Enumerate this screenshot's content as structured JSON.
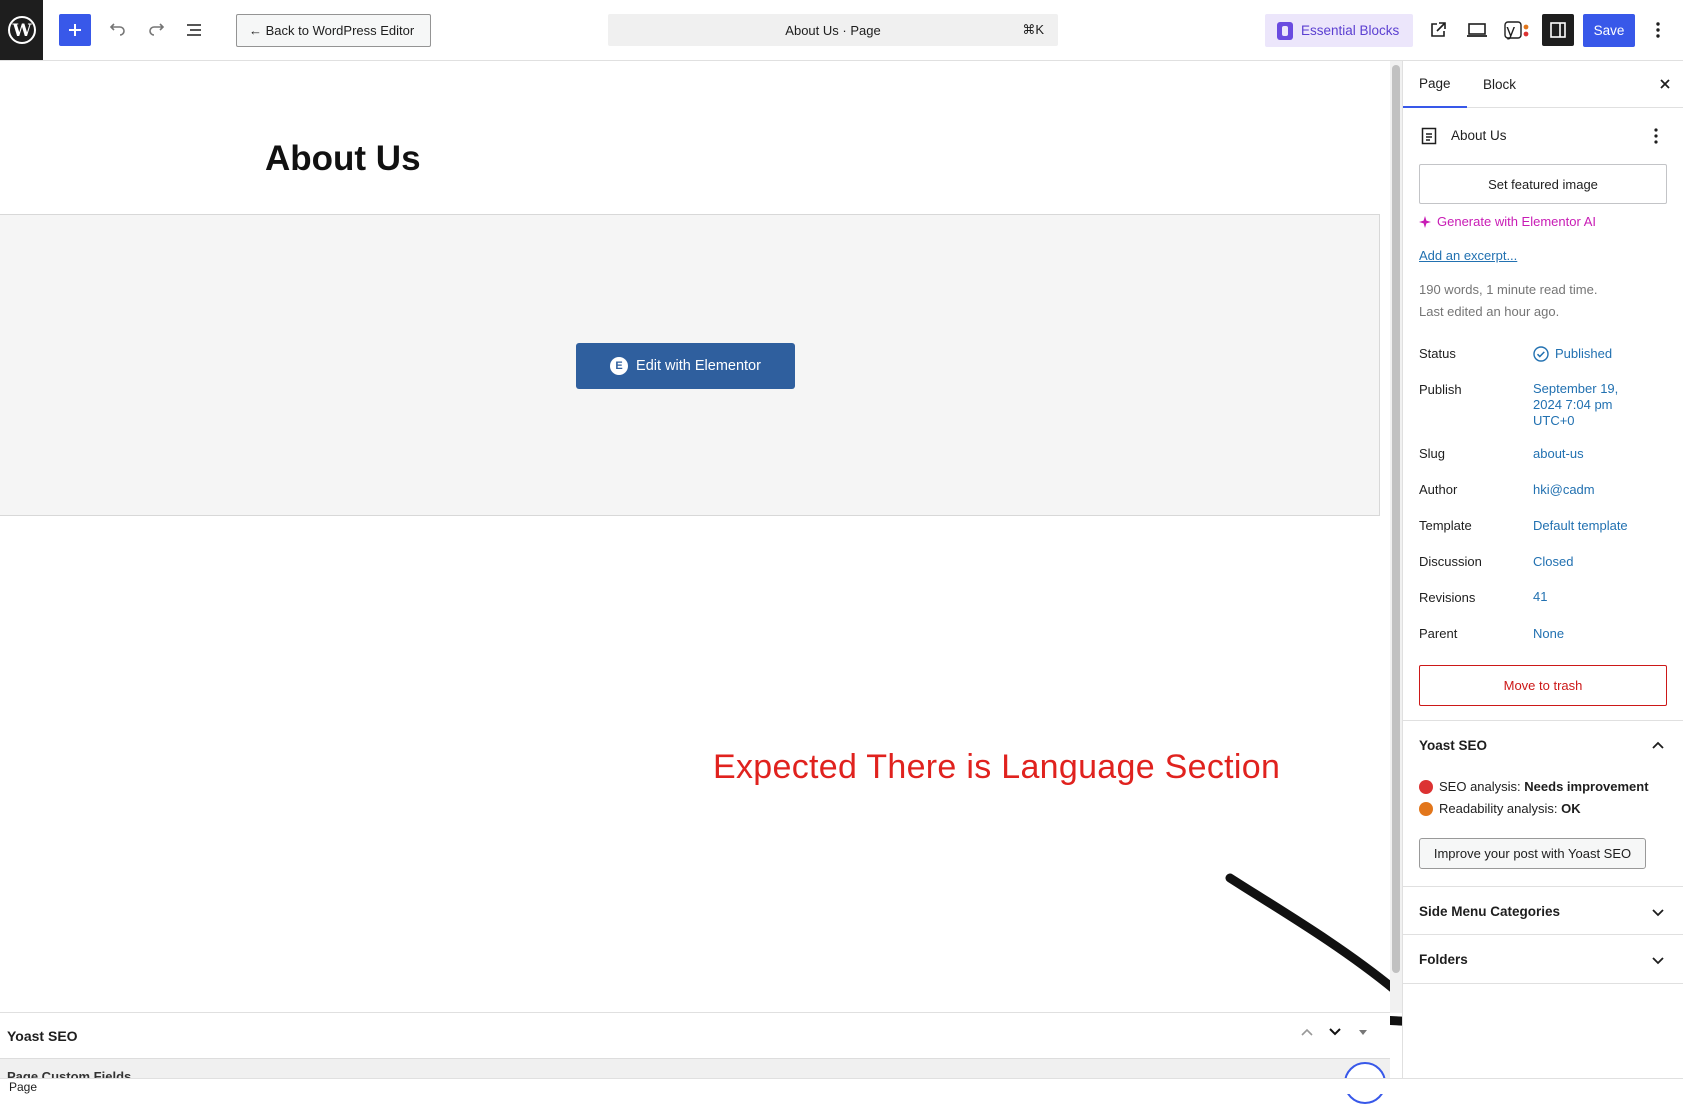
{
  "toolbar": {
    "back_label": "← Back to WordPress Editor",
    "command_title": "About Us · Page",
    "command_shortcut": "⌘K",
    "essential_blocks_label": "Essential Blocks",
    "save_label": "Save"
  },
  "canvas": {
    "page_title": "About Us",
    "elementor_button": "Edit with Elementor",
    "annotation": "Expected There is Language Section"
  },
  "meta_boxes": {
    "yoast_title": "Yoast SEO",
    "next_box_title": "Page Custom Fields"
  },
  "footer": {
    "breadcrumb": "Page"
  },
  "sidebar": {
    "tabs": [
      "Page",
      "Block"
    ],
    "doc_title": "About Us",
    "featured_image_label": "Set featured image",
    "generate_ai_label": "Generate with Elementor AI",
    "excerpt_link": "Add an excerpt...",
    "word_count": "190 words, 1 minute read time.",
    "last_edited": "Last edited an hour ago.",
    "rows": [
      {
        "label": "Status",
        "value": "Published"
      },
      {
        "label": "Publish",
        "value": "September 19, 2024 7:04 pm UTC+0"
      },
      {
        "label": "Slug",
        "value": "about-us"
      },
      {
        "label": "Author",
        "value": "hki@cadm"
      },
      {
        "label": "Template",
        "value": "Default template"
      },
      {
        "label": "Discussion",
        "value": "Closed"
      },
      {
        "label": "Revisions",
        "value": "41"
      },
      {
        "label": "Parent",
        "value": "None"
      }
    ],
    "trash_label": "Move to trash",
    "yoast": {
      "title": "Yoast SEO",
      "seo_label": "SEO analysis:",
      "seo_value": "Needs improvement",
      "readability_label": "Readability analysis:",
      "readability_value": "OK",
      "improve_button": "Improve your post with Yoast SEO"
    },
    "side_menu_title": "Side Menu Categories",
    "folders_title": "Folders"
  },
  "colors": {
    "accent": "#3858e9",
    "link": "#2271b1",
    "danger": "#cc1818",
    "annotation": "#e0221e",
    "ai": "#c81cb5"
  }
}
